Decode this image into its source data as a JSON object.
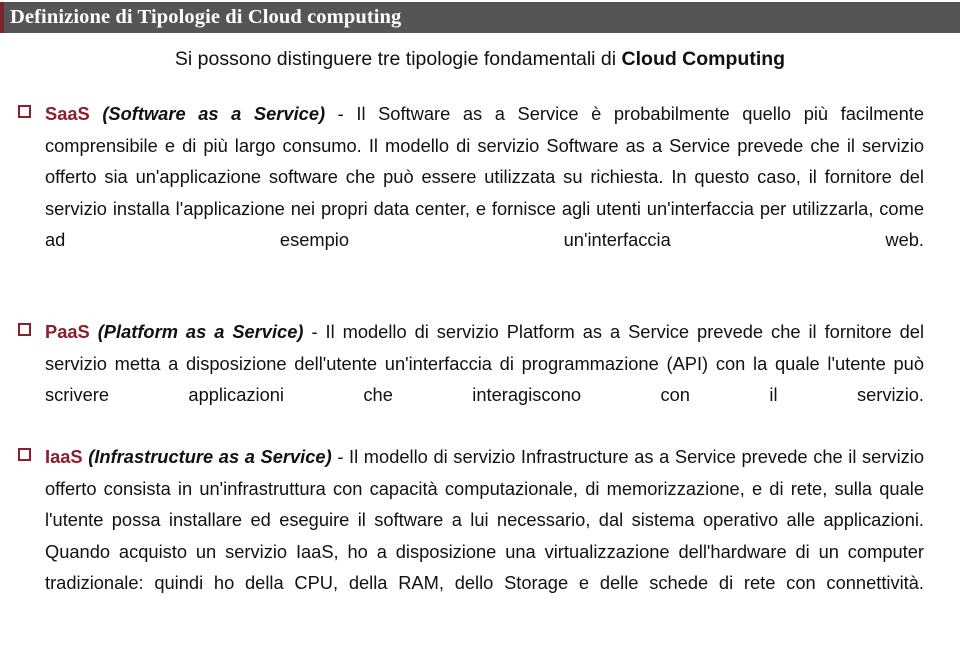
{
  "header": {
    "title": "Definizione di Tipologie di Cloud computing",
    "bar_color": "#555555",
    "accent_color": "#7a2430",
    "text_color": "#ffffff"
  },
  "slide": {
    "intro": {
      "text_plain": "Si possono distinguere tre tipologie fondamentali di Cloud Computing",
      "lead": "Si possono distinguere tre tipologie fondamentali di ",
      "emphasis": "Cloud Computing"
    },
    "bullet_marker": "❑",
    "accent_color": "#8b1f2d",
    "bullets": [
      {
        "acronym": "SaaS",
        "term": "(Software as a Service)",
        "separator": " - ",
        "body": "Il Software as a Service è probabilmente quello più facilmente comprensibile e di più largo consumo.  Il modello di servizio Software as a Service prevede che il servizio offerto sia un'applicazione software che può essere utilizzata su richiesta. In questo caso, il fornitore del servizio installa l'applicazione nei propri data center, e fornisce agli utenti un'interfaccia per utilizzarla, come ad esempio un'interfaccia web."
      },
      {
        "acronym": "PaaS",
        "term": "(Platform as a Service)",
        "separator": " - ",
        "body": "Il modello di servizio Platform as a Service prevede che il fornitore del servizio metta a disposizione dell'utente un'interfaccia di programmazione (API) con la quale l'utente può scrivere applicazioni che interagiscono con il servizio."
      },
      {
        "acronym": "IaaS",
        "term": "(Infrastructure as a Service)",
        "separator": " - ",
        "body": "Il modello di servizio Infrastructure as a Service prevede che il servizio offerto consista in un'infrastruttura con capacità computazionale, di memorizzazione, e di rete, sulla quale l'utente possa installare ed eseguire il software a lui necessario, dal sistema operativo alle applicazioni. Quando acquisto un servizio IaaS, ho a disposizione una virtualizzazione dell'hardware di un computer tradizionale: quindi ho della CPU, della RAM, dello Storage e delle schede di rete con connettività."
      }
    ]
  }
}
